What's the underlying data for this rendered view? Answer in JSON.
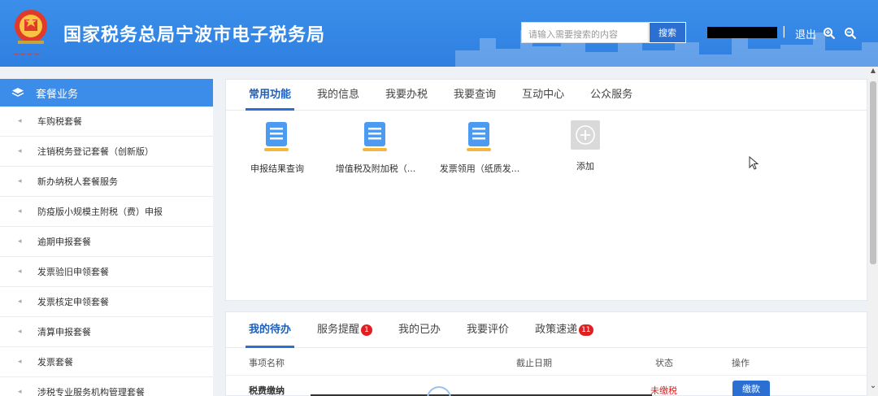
{
  "header": {
    "title": "国家税务总局宁波市电子税务局",
    "search_placeholder": "请输入需要搜索的内容",
    "search_button": "搜索",
    "separator": "|",
    "logout": "退出",
    "brand_color": "#2f7fe0"
  },
  "sidebar": {
    "title": "套餐业务",
    "items": [
      {
        "label": "车购税套餐"
      },
      {
        "label": "注销税务登记套餐（创新版）"
      },
      {
        "label": "新办纳税人套餐服务"
      },
      {
        "label": "防疫版小规模主附税（费）申报"
      },
      {
        "label": "逾期申报套餐"
      },
      {
        "label": "发票验旧申领套餐"
      },
      {
        "label": "发票核定申领套餐"
      },
      {
        "label": "清算申报套餐"
      },
      {
        "label": "发票套餐"
      },
      {
        "label": "涉税专业服务机构管理套餐"
      }
    ]
  },
  "main": {
    "tabs": [
      "常用功能",
      "我的信息",
      "我要办税",
      "我要查询",
      "互动中心",
      "公众服务"
    ],
    "functions": [
      {
        "label": "申报结果查询",
        "icon": "document-icon"
      },
      {
        "label": "增值税及附加税（...",
        "icon": "document-icon"
      },
      {
        "label": "发票领用（纸质发...",
        "icon": "document-icon"
      },
      {
        "label": "添加",
        "icon": "plus-icon"
      }
    ]
  },
  "todo": {
    "tabs": [
      {
        "label": "我的待办",
        "badge": ""
      },
      {
        "label": "服务提醒",
        "badge": "1"
      },
      {
        "label": "我的已办",
        "badge": ""
      },
      {
        "label": "我要评价",
        "badge": ""
      },
      {
        "label": "政策速递",
        "badge": "11"
      }
    ],
    "columns": {
      "name": "事项名称",
      "deadline": "截止日期",
      "status": "状态",
      "action": "操作"
    },
    "rows": [
      {
        "name": "税费缴纳",
        "deadline": "",
        "status": "未缴税",
        "action": "缴款"
      }
    ]
  }
}
